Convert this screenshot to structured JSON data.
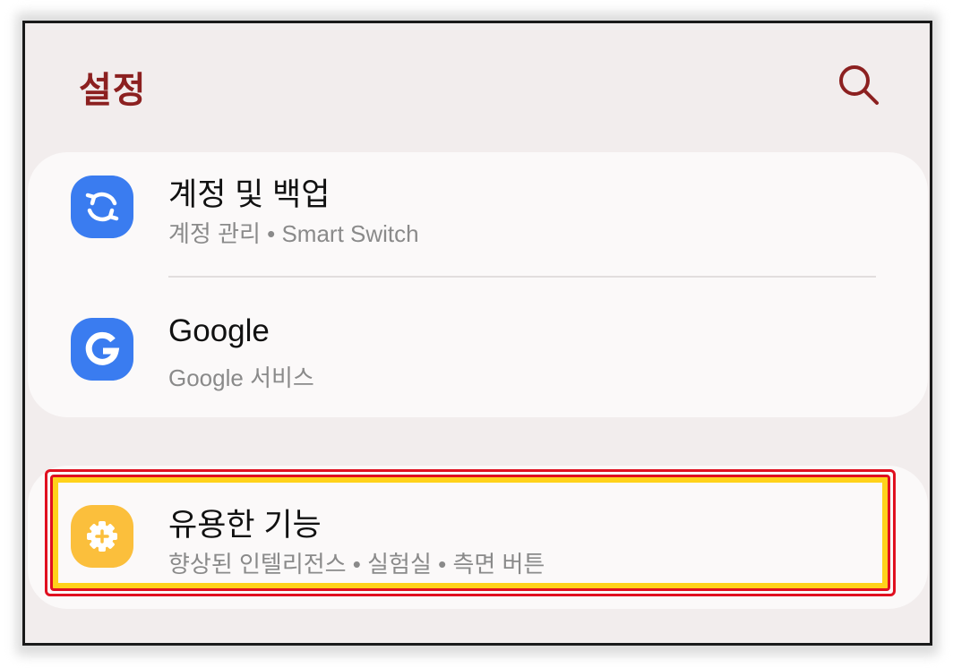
{
  "header": {
    "title": "설정"
  },
  "icons": {
    "search": "search-icon",
    "account_backup": "sync-arrows-icon",
    "google": "google-g-icon",
    "advanced_features": "gear-plus-icon"
  },
  "colors": {
    "title": "#8c2020",
    "background": "#f2eded",
    "card": "#fbf9f9",
    "blue_icon": "#3a7cf0",
    "yellow_icon": "#fbbf3c",
    "highlight_border": "#e01020",
    "highlight_fill": "#ffd21a"
  },
  "settings": {
    "account_backup": {
      "title": "계정 및 백업",
      "subtitle": "계정 관리  •  Smart Switch"
    },
    "google": {
      "title": "Google",
      "subtitle": "Google 서비스"
    },
    "advanced_features": {
      "title": "유용한 기능",
      "subtitle": "향상된 인텔리전스  •  실험실  •  측면 버튼"
    }
  }
}
